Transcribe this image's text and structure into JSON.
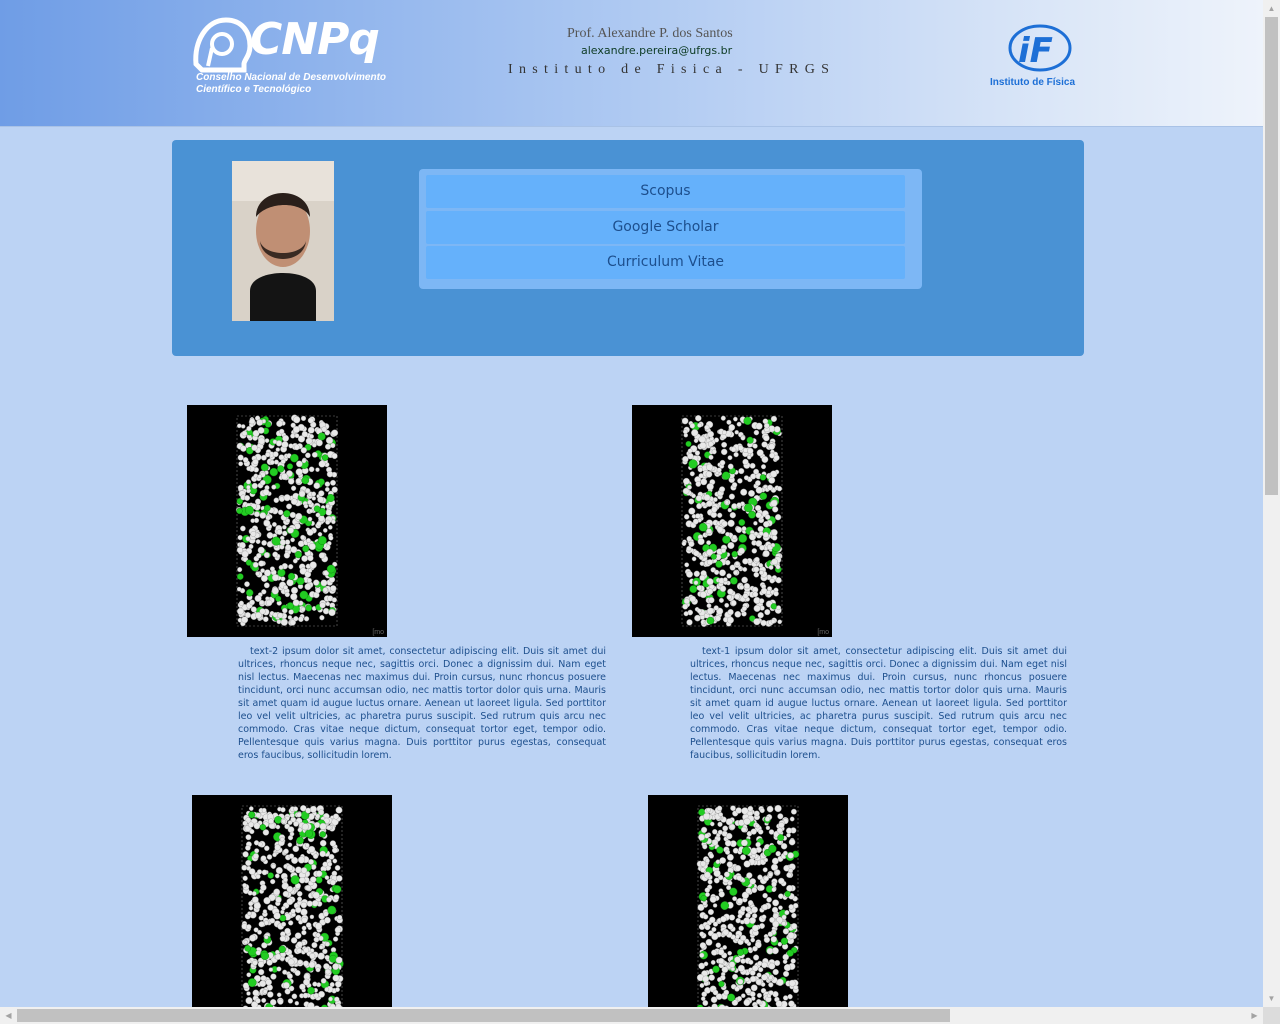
{
  "header": {
    "cnpq_logo_text": "CNPq",
    "cnpq_subtitle_line1": "Conselho Nacional de Desenvolvimento",
    "cnpq_subtitle_line2": "Científico e Tecnológico",
    "professor_name": "Prof. Alexandre P. dos Santos",
    "email": "alexandre.pereira@ufrgs.br",
    "institute": "Instituto de Fisica - UFRGS",
    "if_logo_text": "iF",
    "if_caption": "Instituto de Física"
  },
  "profile": {
    "links": [
      {
        "label": "Scopus"
      },
      {
        "label": "Google Scholar"
      },
      {
        "label": "Curriculum Vitae"
      }
    ]
  },
  "gallery": [
    {
      "image_icon": "molecular-simulation-image",
      "image_tag": "[mo",
      "text": "text-2 ipsum dolor sit amet, consectetur adipiscing elit. Duis sit amet dui ultrices, rhoncus neque nec, sagittis orci. Donec a dignissim dui. Nam eget nisl lectus. Maecenas nec maximus dui. Proin cursus, nunc rhoncus posuere tincidunt, orci nunc accumsan odio, nec mattis tortor dolor quis urna. Mauris sit amet quam id augue luctus ornare. Aenean ut laoreet ligula. Sed porttitor leo vel velit ultricies, ac pharetra purus suscipit. Sed rutrum quis arcu nec commodo. Cras vitae neque dictum, consequat tortor eget, tempor odio. Pellentesque quis varius magna. Duis porttitor purus egestas, consequat eros faucibus, sollicitudin lorem."
    },
    {
      "image_icon": "molecular-simulation-image",
      "image_tag": "[mo",
      "text": "text-1 ipsum dolor sit amet, consectetur adipiscing elit. Duis sit amet dui ultrices, rhoncus neque nec, sagittis orci. Donec a dignissim dui. Nam eget nisl lectus. Maecenas nec maximus dui. Proin cursus, nunc rhoncus posuere tincidunt, orci nunc accumsan odio, nec mattis tortor dolor quis urna. Mauris sit amet quam id augue luctus ornare. Aenean ut laoreet ligula. Sed porttitor leo vel velit ultricies, ac pharetra purus suscipit. Sed rutrum quis arcu nec commodo. Cras vitae neque dictum, consequat tortor eget, tempor odio. Pellentesque quis varius magna. Duis porttitor purus egestas, consequat eros faucibus, sollicitudin lorem."
    },
    {
      "image_icon": "molecular-simulation-image"
    },
    {
      "image_icon": "molecular-simulation-image"
    }
  ],
  "colors": {
    "page_bg": "#bcd3f4",
    "panel_bg": "#4a92d4",
    "links_box_bg": "#7db7f5",
    "link_button_bg": "#65b1fb",
    "link_text": "#1d4f8d",
    "particle_green": "#22cc22",
    "particle_white": "#e8e8e8"
  }
}
